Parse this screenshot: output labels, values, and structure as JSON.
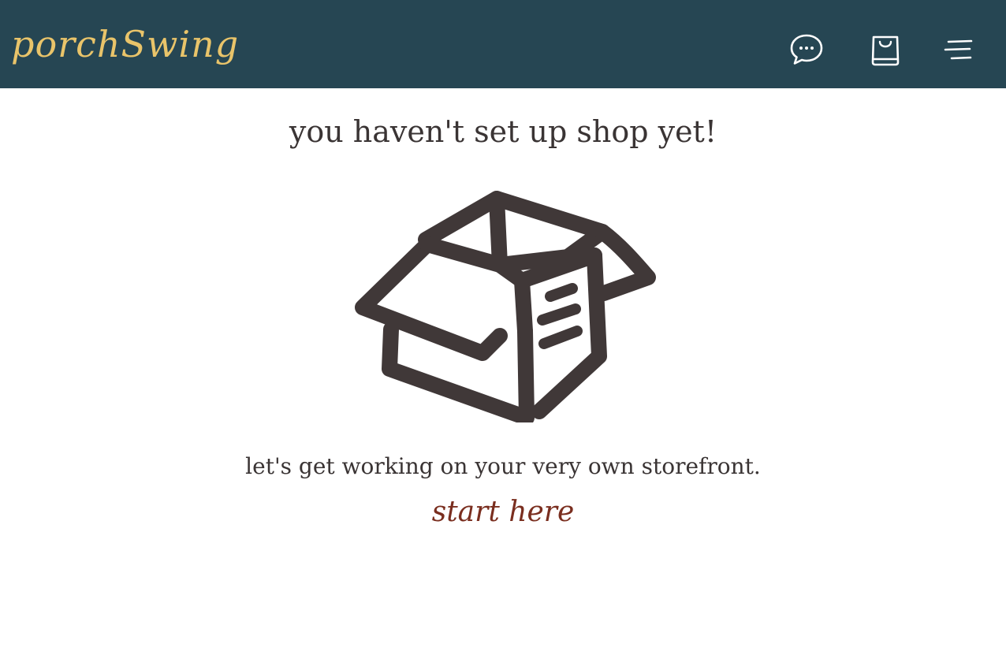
{
  "header": {
    "logo_text": "porchSwing",
    "colors": {
      "background": "#264653",
      "logo": "#e9c46a",
      "icons": "#ffffff"
    },
    "icons": [
      "chat-bubble-icon",
      "shopping-bag-icon",
      "menu-icon"
    ]
  },
  "main": {
    "heading": "you haven't set up shop yet!",
    "illustration": "open-box-icon",
    "subtext": "let's get working on your very own storefront.",
    "cta_label": "start here",
    "colors": {
      "text": "#3a3434",
      "cta": "#7a2e1f",
      "illustration": "#403838"
    }
  }
}
